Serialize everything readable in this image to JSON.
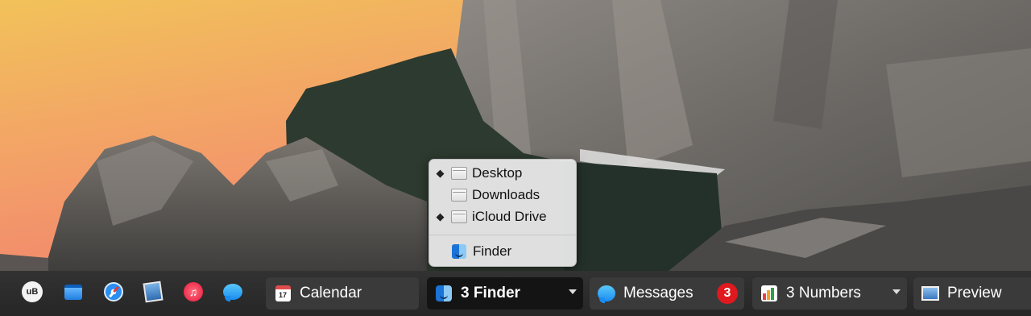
{
  "popup_menu": {
    "items": [
      {
        "label": "Desktop",
        "marked": true,
        "icon": "folder-icon"
      },
      {
        "label": "Downloads",
        "marked": false,
        "icon": "folder-icon"
      },
      {
        "label": "iCloud Drive",
        "marked": true,
        "icon": "folder-icon"
      }
    ],
    "app_item": {
      "label": "Finder",
      "icon": "finder-icon"
    },
    "mark_glyph": "◆"
  },
  "taskbar": {
    "launcher_icons": [
      {
        "name": "ubar-logo-icon",
        "text": "uB"
      },
      {
        "name": "window-icon"
      },
      {
        "name": "safari-icon"
      },
      {
        "name": "preview-photo-icon"
      },
      {
        "name": "itunes-icon",
        "text": "♫"
      },
      {
        "name": "messages-icon"
      }
    ],
    "buttons": [
      {
        "label": "Calendar",
        "icon": "calendar-icon",
        "icon_text": "17"
      },
      {
        "label": "3 Finder",
        "icon": "finder-icon",
        "active": true,
        "has_menu": true
      },
      {
        "label": "Messages",
        "icon": "messages-icon",
        "badge": "3"
      },
      {
        "label": "3 Numbers",
        "icon": "numbers-icon",
        "has_menu": true
      },
      {
        "label": "Preview",
        "icon": "preview-icon"
      }
    ]
  },
  "colors": {
    "taskbar_bg": "#2b2b2b",
    "active_button_bg": "#141414",
    "badge": "#e0191f",
    "sky_top": "#f3c25b",
    "sky_bottom": "#f08a6e"
  }
}
